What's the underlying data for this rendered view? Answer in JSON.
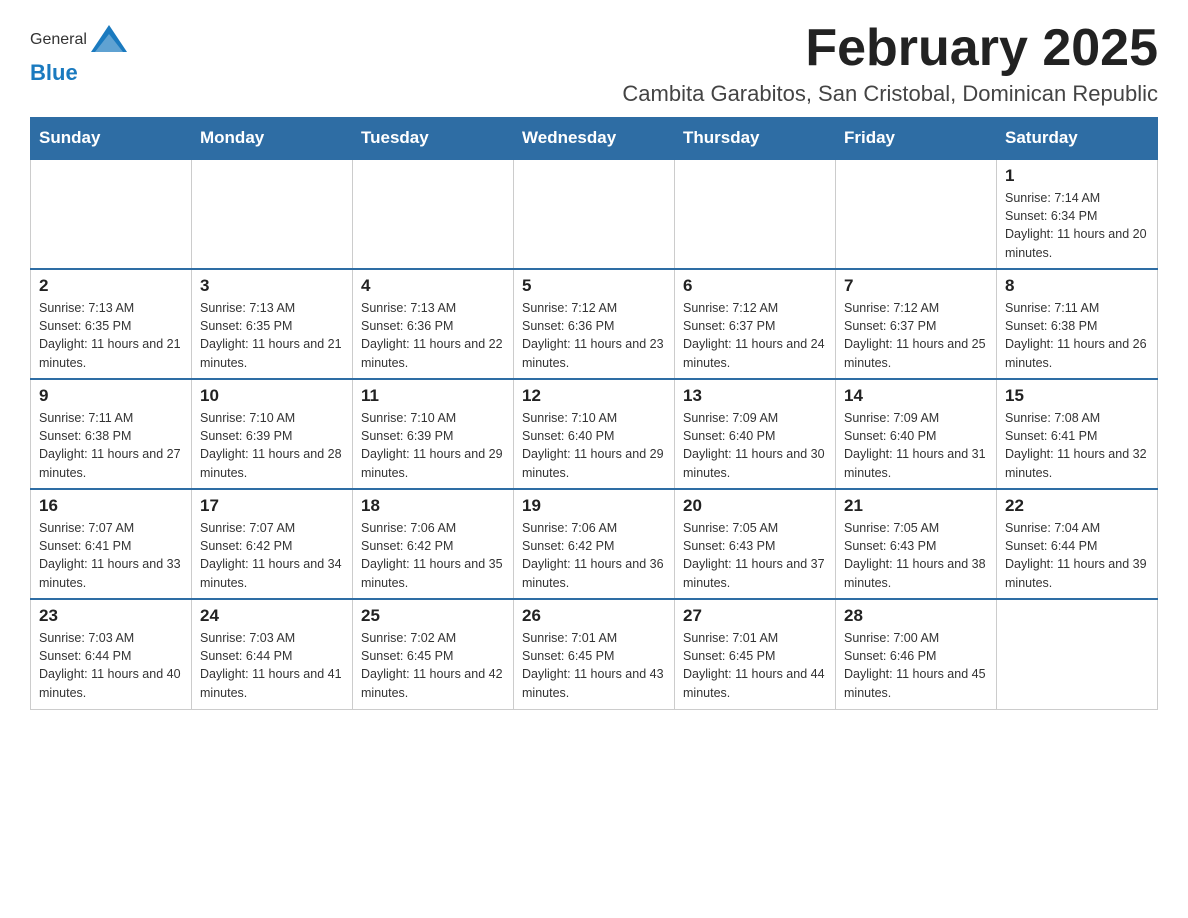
{
  "header": {
    "logo_general": "General",
    "logo_blue": "Blue",
    "month_title": "February 2025",
    "location": "Cambita Garabitos, San Cristobal, Dominican Republic"
  },
  "weekdays": [
    "Sunday",
    "Monday",
    "Tuesday",
    "Wednesday",
    "Thursday",
    "Friday",
    "Saturday"
  ],
  "weeks": [
    [
      {
        "day": "",
        "info": ""
      },
      {
        "day": "",
        "info": ""
      },
      {
        "day": "",
        "info": ""
      },
      {
        "day": "",
        "info": ""
      },
      {
        "day": "",
        "info": ""
      },
      {
        "day": "",
        "info": ""
      },
      {
        "day": "1",
        "info": "Sunrise: 7:14 AM\nSunset: 6:34 PM\nDaylight: 11 hours and 20 minutes."
      }
    ],
    [
      {
        "day": "2",
        "info": "Sunrise: 7:13 AM\nSunset: 6:35 PM\nDaylight: 11 hours and 21 minutes."
      },
      {
        "day": "3",
        "info": "Sunrise: 7:13 AM\nSunset: 6:35 PM\nDaylight: 11 hours and 21 minutes."
      },
      {
        "day": "4",
        "info": "Sunrise: 7:13 AM\nSunset: 6:36 PM\nDaylight: 11 hours and 22 minutes."
      },
      {
        "day": "5",
        "info": "Sunrise: 7:12 AM\nSunset: 6:36 PM\nDaylight: 11 hours and 23 minutes."
      },
      {
        "day": "6",
        "info": "Sunrise: 7:12 AM\nSunset: 6:37 PM\nDaylight: 11 hours and 24 minutes."
      },
      {
        "day": "7",
        "info": "Sunrise: 7:12 AM\nSunset: 6:37 PM\nDaylight: 11 hours and 25 minutes."
      },
      {
        "day": "8",
        "info": "Sunrise: 7:11 AM\nSunset: 6:38 PM\nDaylight: 11 hours and 26 minutes."
      }
    ],
    [
      {
        "day": "9",
        "info": "Sunrise: 7:11 AM\nSunset: 6:38 PM\nDaylight: 11 hours and 27 minutes."
      },
      {
        "day": "10",
        "info": "Sunrise: 7:10 AM\nSunset: 6:39 PM\nDaylight: 11 hours and 28 minutes."
      },
      {
        "day": "11",
        "info": "Sunrise: 7:10 AM\nSunset: 6:39 PM\nDaylight: 11 hours and 29 minutes."
      },
      {
        "day": "12",
        "info": "Sunrise: 7:10 AM\nSunset: 6:40 PM\nDaylight: 11 hours and 29 minutes."
      },
      {
        "day": "13",
        "info": "Sunrise: 7:09 AM\nSunset: 6:40 PM\nDaylight: 11 hours and 30 minutes."
      },
      {
        "day": "14",
        "info": "Sunrise: 7:09 AM\nSunset: 6:40 PM\nDaylight: 11 hours and 31 minutes."
      },
      {
        "day": "15",
        "info": "Sunrise: 7:08 AM\nSunset: 6:41 PM\nDaylight: 11 hours and 32 minutes."
      }
    ],
    [
      {
        "day": "16",
        "info": "Sunrise: 7:07 AM\nSunset: 6:41 PM\nDaylight: 11 hours and 33 minutes."
      },
      {
        "day": "17",
        "info": "Sunrise: 7:07 AM\nSunset: 6:42 PM\nDaylight: 11 hours and 34 minutes."
      },
      {
        "day": "18",
        "info": "Sunrise: 7:06 AM\nSunset: 6:42 PM\nDaylight: 11 hours and 35 minutes."
      },
      {
        "day": "19",
        "info": "Sunrise: 7:06 AM\nSunset: 6:42 PM\nDaylight: 11 hours and 36 minutes."
      },
      {
        "day": "20",
        "info": "Sunrise: 7:05 AM\nSunset: 6:43 PM\nDaylight: 11 hours and 37 minutes."
      },
      {
        "day": "21",
        "info": "Sunrise: 7:05 AM\nSunset: 6:43 PM\nDaylight: 11 hours and 38 minutes."
      },
      {
        "day": "22",
        "info": "Sunrise: 7:04 AM\nSunset: 6:44 PM\nDaylight: 11 hours and 39 minutes."
      }
    ],
    [
      {
        "day": "23",
        "info": "Sunrise: 7:03 AM\nSunset: 6:44 PM\nDaylight: 11 hours and 40 minutes."
      },
      {
        "day": "24",
        "info": "Sunrise: 7:03 AM\nSunset: 6:44 PM\nDaylight: 11 hours and 41 minutes."
      },
      {
        "day": "25",
        "info": "Sunrise: 7:02 AM\nSunset: 6:45 PM\nDaylight: 11 hours and 42 minutes."
      },
      {
        "day": "26",
        "info": "Sunrise: 7:01 AM\nSunset: 6:45 PM\nDaylight: 11 hours and 43 minutes."
      },
      {
        "day": "27",
        "info": "Sunrise: 7:01 AM\nSunset: 6:45 PM\nDaylight: 11 hours and 44 minutes."
      },
      {
        "day": "28",
        "info": "Sunrise: 7:00 AM\nSunset: 6:46 PM\nDaylight: 11 hours and 45 minutes."
      },
      {
        "day": "",
        "info": ""
      }
    ]
  ]
}
